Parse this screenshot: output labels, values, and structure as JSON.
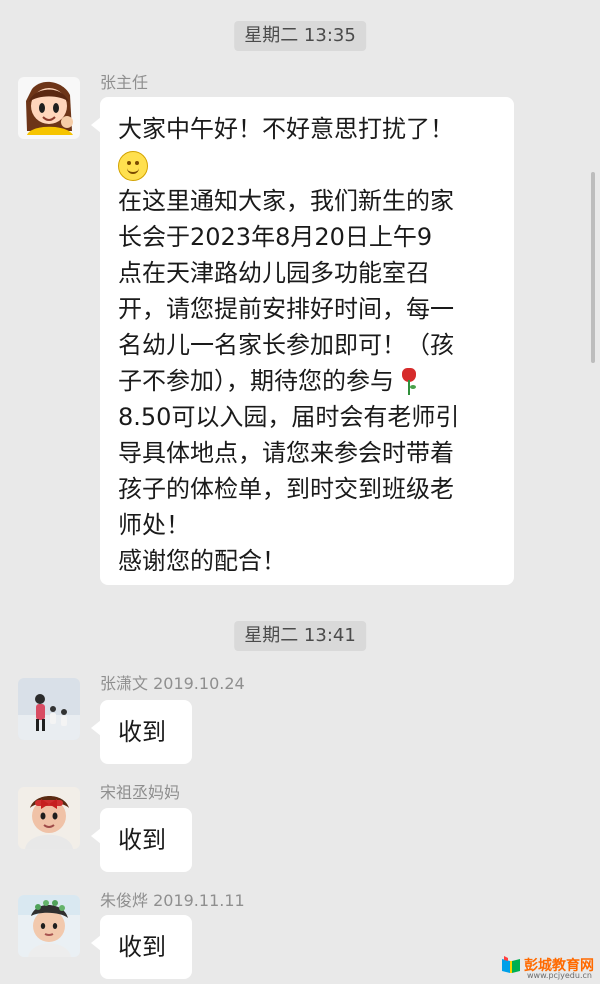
{
  "chat": {
    "time_markers": [
      "星期二 13:35",
      "星期二 13:41"
    ],
    "messages": [
      {
        "sender": "张主任",
        "lines": [
          "大家中午好！不好意思打扰了！",
          "",
          "在这里通知大家，我们新生的家",
          "长会于2023年8月20日上午9",
          "点在天津路幼儿园多功能室召",
          "开，请您提前安排好时间，每一",
          "名幼儿一名家长参加即可！（孩",
          "子不参加），期待您的参与",
          "8.50可以入园，届时会有老师引",
          "导具体地点，请您来参会时带着",
          "孩子的体检单，到时交到班级老",
          "师处！",
          "感谢您的配合！"
        ]
      },
      {
        "sender": "张潇文 2019.10.24",
        "text": "收到"
      },
      {
        "sender": "宋祖丞妈妈",
        "text": "收到"
      },
      {
        "sender": "朱俊烨 2019.11.11",
        "text": "收到"
      }
    ]
  },
  "icons": {
    "smile": "smiling-face-emoji",
    "rose": "rose-emoji"
  },
  "watermark": {
    "title": "彭城教育网",
    "url": "www.pcjyedu.cn"
  },
  "colors": {
    "background": "#e9e9e9",
    "bubble": "#ffffff",
    "time_pill": "#d9d9d9",
    "sender_text": "#8f8f8f"
  }
}
